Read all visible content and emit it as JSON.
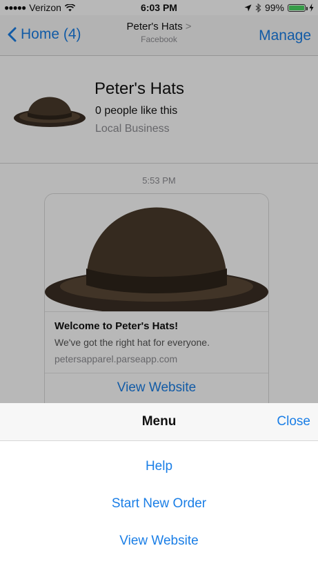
{
  "status_bar": {
    "carrier": "Verizon",
    "time": "6:03 PM",
    "battery": "99%",
    "battery_level": 0.99
  },
  "nav": {
    "back_label": "Home (4)",
    "title": "Peter's Hats",
    "subtitle": "Facebook",
    "action_label": "Manage"
  },
  "page": {
    "name": "Peter's Hats",
    "likes": "0 people like this",
    "category": "Local Business"
  },
  "chat": {
    "timestamp": "5:53 PM",
    "card": {
      "title": "Welcome to Peter's Hats!",
      "subtitle": "We've got the right hat for everyone.",
      "url": "petersapparel.parseapp.com",
      "button_label": "View Website"
    }
  },
  "menu": {
    "title": "Menu",
    "close_label": "Close",
    "items": [
      {
        "label": "Help"
      },
      {
        "label": "Start New Order"
      },
      {
        "label": "View Website"
      }
    ]
  },
  "colors": {
    "accent": "#1a7ee6",
    "battery": "#4cd964",
    "hat_brown": "#4a3b2c"
  }
}
